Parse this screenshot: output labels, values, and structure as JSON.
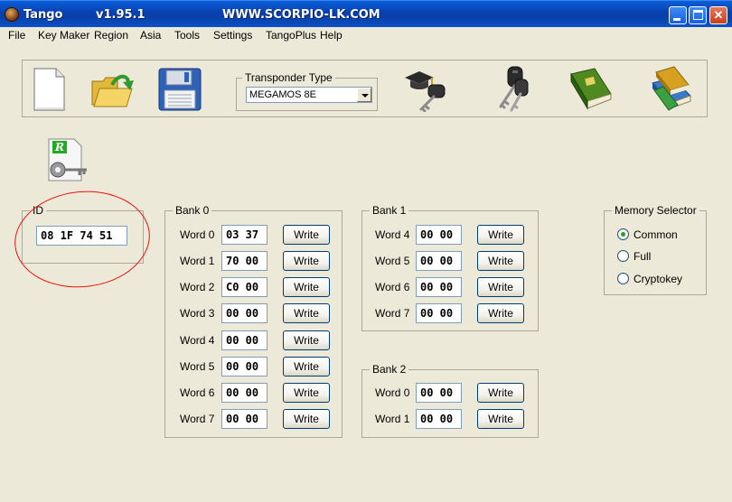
{
  "window": {
    "name": "Tango",
    "version": "v1.95.1",
    "url": "WWW.SCORPIO-LK.COM",
    "close_glyph": "✕"
  },
  "menu": [
    "File",
    "Key Maker",
    "Region",
    "Asia",
    "Tools",
    "Settings",
    "TangoPlus",
    "Help"
  ],
  "toolbar": {
    "transponder_type_label": "Transponder Type",
    "transponder_type_value": "MEGAMOS 8E",
    "icons": [
      "new-file-icon",
      "open-folder-icon",
      "save-floppy-icon",
      "key-graduate-icon",
      "keys-icon",
      "book-icon",
      "books-stack-icon",
      "report-key-icon"
    ],
    "report_badge": "R"
  },
  "id_panel": {
    "label": "ID",
    "value": "08 1F 74 51"
  },
  "bank0": {
    "label": "Bank 0",
    "rows": [
      {
        "label": "Word 0",
        "value": "03 37",
        "button": "Write"
      },
      {
        "label": "Word 1",
        "value": "70 00",
        "button": "Write"
      },
      {
        "label": "Word 2",
        "value": "C0 00",
        "button": "Write"
      },
      {
        "label": "Word 3",
        "value": "00 00",
        "button": "Write"
      },
      {
        "label": "Word 4",
        "value": "00 00",
        "button": "Write"
      },
      {
        "label": "Word 5",
        "value": "00 00",
        "button": "Write"
      },
      {
        "label": "Word 6",
        "value": "00 00",
        "button": "Write"
      },
      {
        "label": "Word 7",
        "value": "00 00",
        "button": "Write"
      }
    ]
  },
  "bank1": {
    "label": "Bank 1",
    "rows": [
      {
        "label": "Word 4",
        "value": "00 00",
        "button": "Write"
      },
      {
        "label": "Word 5",
        "value": "00 00",
        "button": "Write"
      },
      {
        "label": "Word 6",
        "value": "00 00",
        "button": "Write"
      },
      {
        "label": "Word 7",
        "value": "00 00",
        "button": "Write"
      }
    ]
  },
  "bank2": {
    "label": "Bank 2",
    "rows": [
      {
        "label": "Word 0",
        "value": "00 00",
        "button": "Write"
      },
      {
        "label": "Word 1",
        "value": "00 00",
        "button": "Write"
      }
    ]
  },
  "memory_selector": {
    "label": "Memory Selector",
    "options": [
      "Common",
      "Full",
      "Cryptokey"
    ],
    "selected": "Common"
  },
  "colors": {
    "titlebar": "#0a3fa8",
    "annotation": "#ee1111",
    "face": "#ece9d8"
  }
}
